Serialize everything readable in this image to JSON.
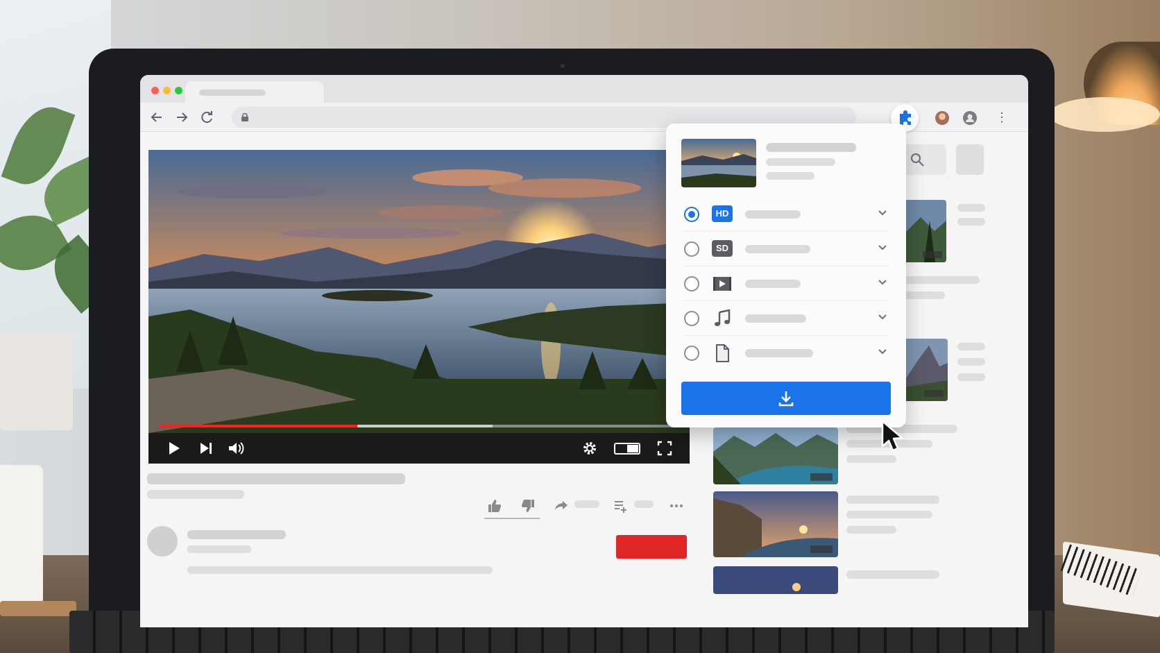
{
  "browser": {
    "window_controls": [
      "close",
      "minimize",
      "maximize"
    ],
    "traffic_light_colors": {
      "close": "#ff5f57",
      "minimize": "#febc2e",
      "maximize": "#28c840"
    },
    "nav_icons": [
      "back-arrow-icon",
      "forward-arrow-icon",
      "reload-icon"
    ],
    "extension_icon": "puzzle-icon",
    "accent": "#1a73e8"
  },
  "player": {
    "progress_fraction": 0.38,
    "buffered_fraction": 0.64,
    "controls_left": [
      "play-icon",
      "next-icon",
      "volume-icon"
    ],
    "controls_right": [
      "settings-gear-icon",
      "theater-mode-icon",
      "fullscreen-icon"
    ],
    "progress_color": "#ff1f1f"
  },
  "video_actions": [
    "like-icon",
    "dislike-icon",
    "share-icon",
    "save-playlist-icon",
    "more-icon"
  ],
  "subscribe_color": "#e02525",
  "extension_popup": {
    "formats": [
      {
        "badge": "HD",
        "type": "hd",
        "selected": true
      },
      {
        "badge": "SD",
        "type": "sd",
        "selected": false
      },
      {
        "badge": "",
        "type": "video-file",
        "selected": false
      },
      {
        "badge": "",
        "type": "audio",
        "selected": false
      },
      {
        "badge": "",
        "type": "document",
        "selected": false
      }
    ],
    "download_icon": "download-icon",
    "download_color": "#1a73e8"
  }
}
